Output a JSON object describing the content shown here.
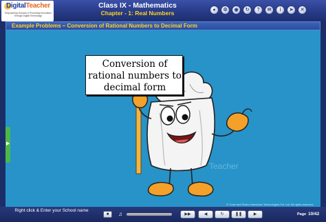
{
  "header": {
    "logo_text_main": "Digital",
    "logo_text_accent": "Teacher",
    "logo_tagline": "Empowering Schools & Promoting Innovation through Digital Technology",
    "title": "Class IX - Mathematics",
    "subtitle": "Chapter - 1: Real Numbers",
    "toolbar_icons": [
      "lock-icon",
      "gear-icon",
      "eye-icon",
      "refresh-icon",
      "help-icon",
      "mail-icon",
      "info-icon",
      "share-icon",
      "close-icon"
    ]
  },
  "section": {
    "title": "Example Problems – Conversion of Rational Numbers to Decimal Form"
  },
  "content": {
    "sign_line1": "Conversion of",
    "sign_line2": "rational numbers to",
    "sign_line3": "decimal form",
    "watermark": "Teacher",
    "copyright": "© Code and Pixels Interactive Technologies Pvt. Ltd. All rights reserved."
  },
  "footer": {
    "school_text": "Right click & Enter your School name",
    "volume_level": 0.0,
    "page_label": "Page",
    "page_number": "10/42"
  },
  "colors": {
    "header_bg": "#273a86",
    "content_bg": "#2793c9",
    "title_accent": "#ffd321"
  }
}
